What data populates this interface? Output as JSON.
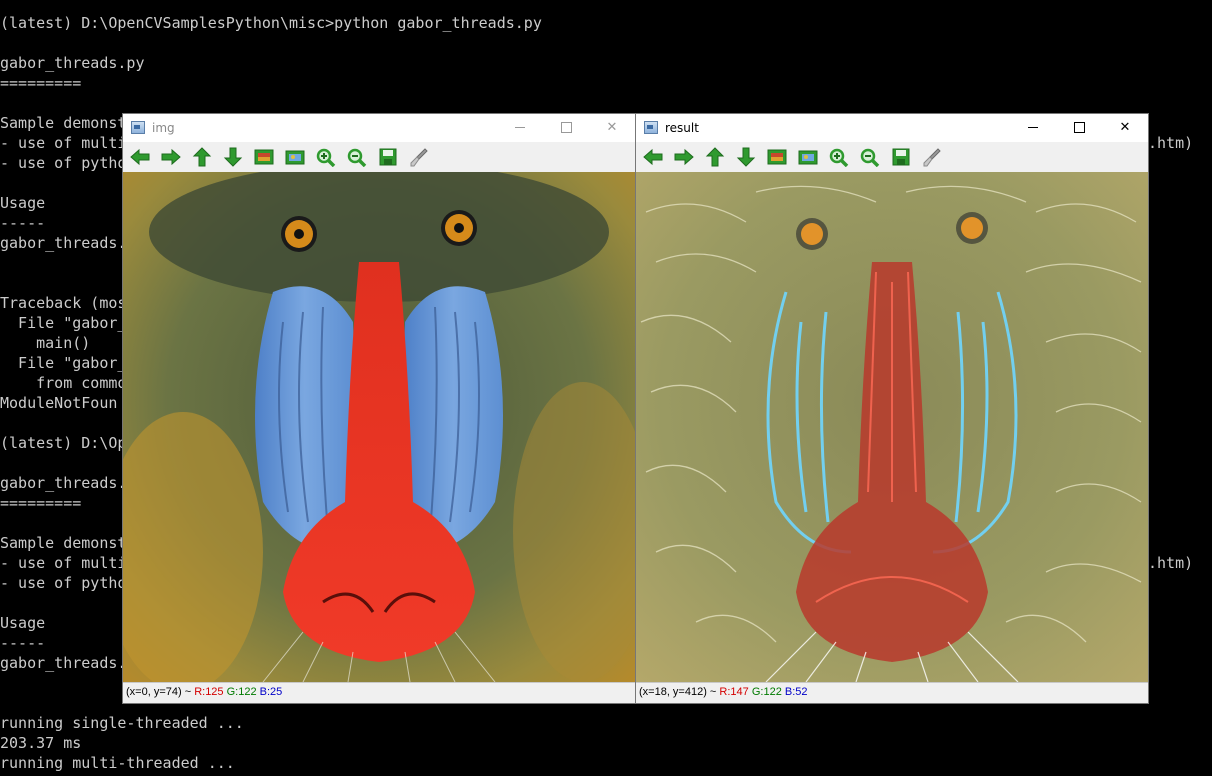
{
  "console": {
    "lines": [
      "(latest) D:\\OpenCVSamplesPython\\misc>python gabor_threads.py",
      "",
      "gabor_threads.py",
      "=========",
      "",
      "Sample demonst",
      "- use of multi",
      "- use of pytho",
      "",
      "Usage",
      "-----",
      "gabor_threads.",
      "",
      "",
      "Traceback (mos",
      "  File \"gabor_",
      "    main()",
      "  File \"gabor_",
      "    from commo",
      "ModuleNotFoun",
      "",
      "(latest) D:\\Op",
      "",
      "gabor_threads.",
      "=========",
      "",
      "Sample demonst",
      "- use of multi",
      "- use of pytho",
      "",
      "Usage",
      "-----",
      "gabor_threads.",
      "",
      "",
      "running single-threaded ...",
      "203.37 ms",
      "running multi-threaded ..."
    ],
    "right_fragments": [
      ".htm)",
      ".htm)"
    ]
  },
  "windows": [
    {
      "title": "img",
      "active": false,
      "toolbar": [
        "arrow-left-icon",
        "arrow-right-icon",
        "arrow-up-icon",
        "arrow-down-icon",
        "image-icon",
        "fit-image-icon",
        "zoom-in-icon",
        "zoom-out-icon",
        "save-icon",
        "properties-icon"
      ],
      "status": {
        "coords": "(x=0, y=74) ~ ",
        "r": "R:125",
        "g": "G:122",
        "b": "B:25"
      }
    },
    {
      "title": "result",
      "active": true,
      "toolbar": [
        "arrow-left-icon",
        "arrow-right-icon",
        "arrow-up-icon",
        "arrow-down-icon",
        "image-icon",
        "fit-image-icon",
        "zoom-in-icon",
        "zoom-out-icon",
        "save-icon",
        "properties-icon"
      ],
      "status": {
        "coords": "(x=18, y=412) ~ ",
        "r": "R:147",
        "g": "G:122",
        "b": "B:52"
      }
    }
  ],
  "colors": {
    "console_bg": "#000000",
    "console_fg": "#cccccc",
    "toolbar_green": "#2f9a2f",
    "status_r": "#d40000",
    "status_g": "#007a00",
    "status_b": "#0000c8"
  }
}
